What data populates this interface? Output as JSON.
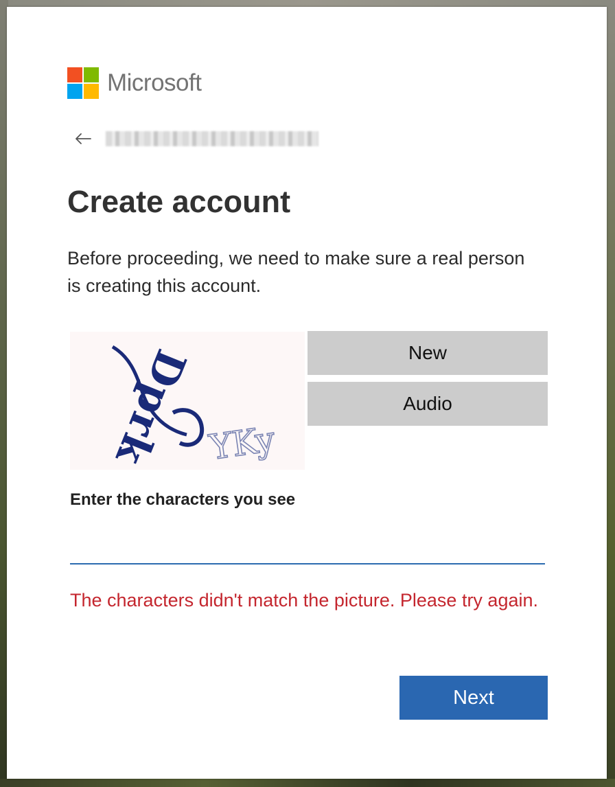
{
  "brand": {
    "name": "Microsoft",
    "colors": {
      "red": "#f25022",
      "green": "#7fba00",
      "blue": "#00a4ef",
      "yellow": "#ffb900"
    }
  },
  "identity": {
    "back_icon": "arrow-left-icon",
    "email_display": "blurred email address"
  },
  "page": {
    "title": "Create account",
    "description": "Before proceeding, we need to make sure a real person is creating this account."
  },
  "captcha": {
    "image_text": "Dprk YKy",
    "new_label": "New",
    "audio_label": "Audio",
    "input_label": "Enter the characters you see",
    "input_value": "",
    "error_message": "The characters didn't match the picture. Please try again."
  },
  "actions": {
    "next_label": "Next",
    "primary_color": "#2a67b1",
    "error_color": "#c4262e"
  }
}
